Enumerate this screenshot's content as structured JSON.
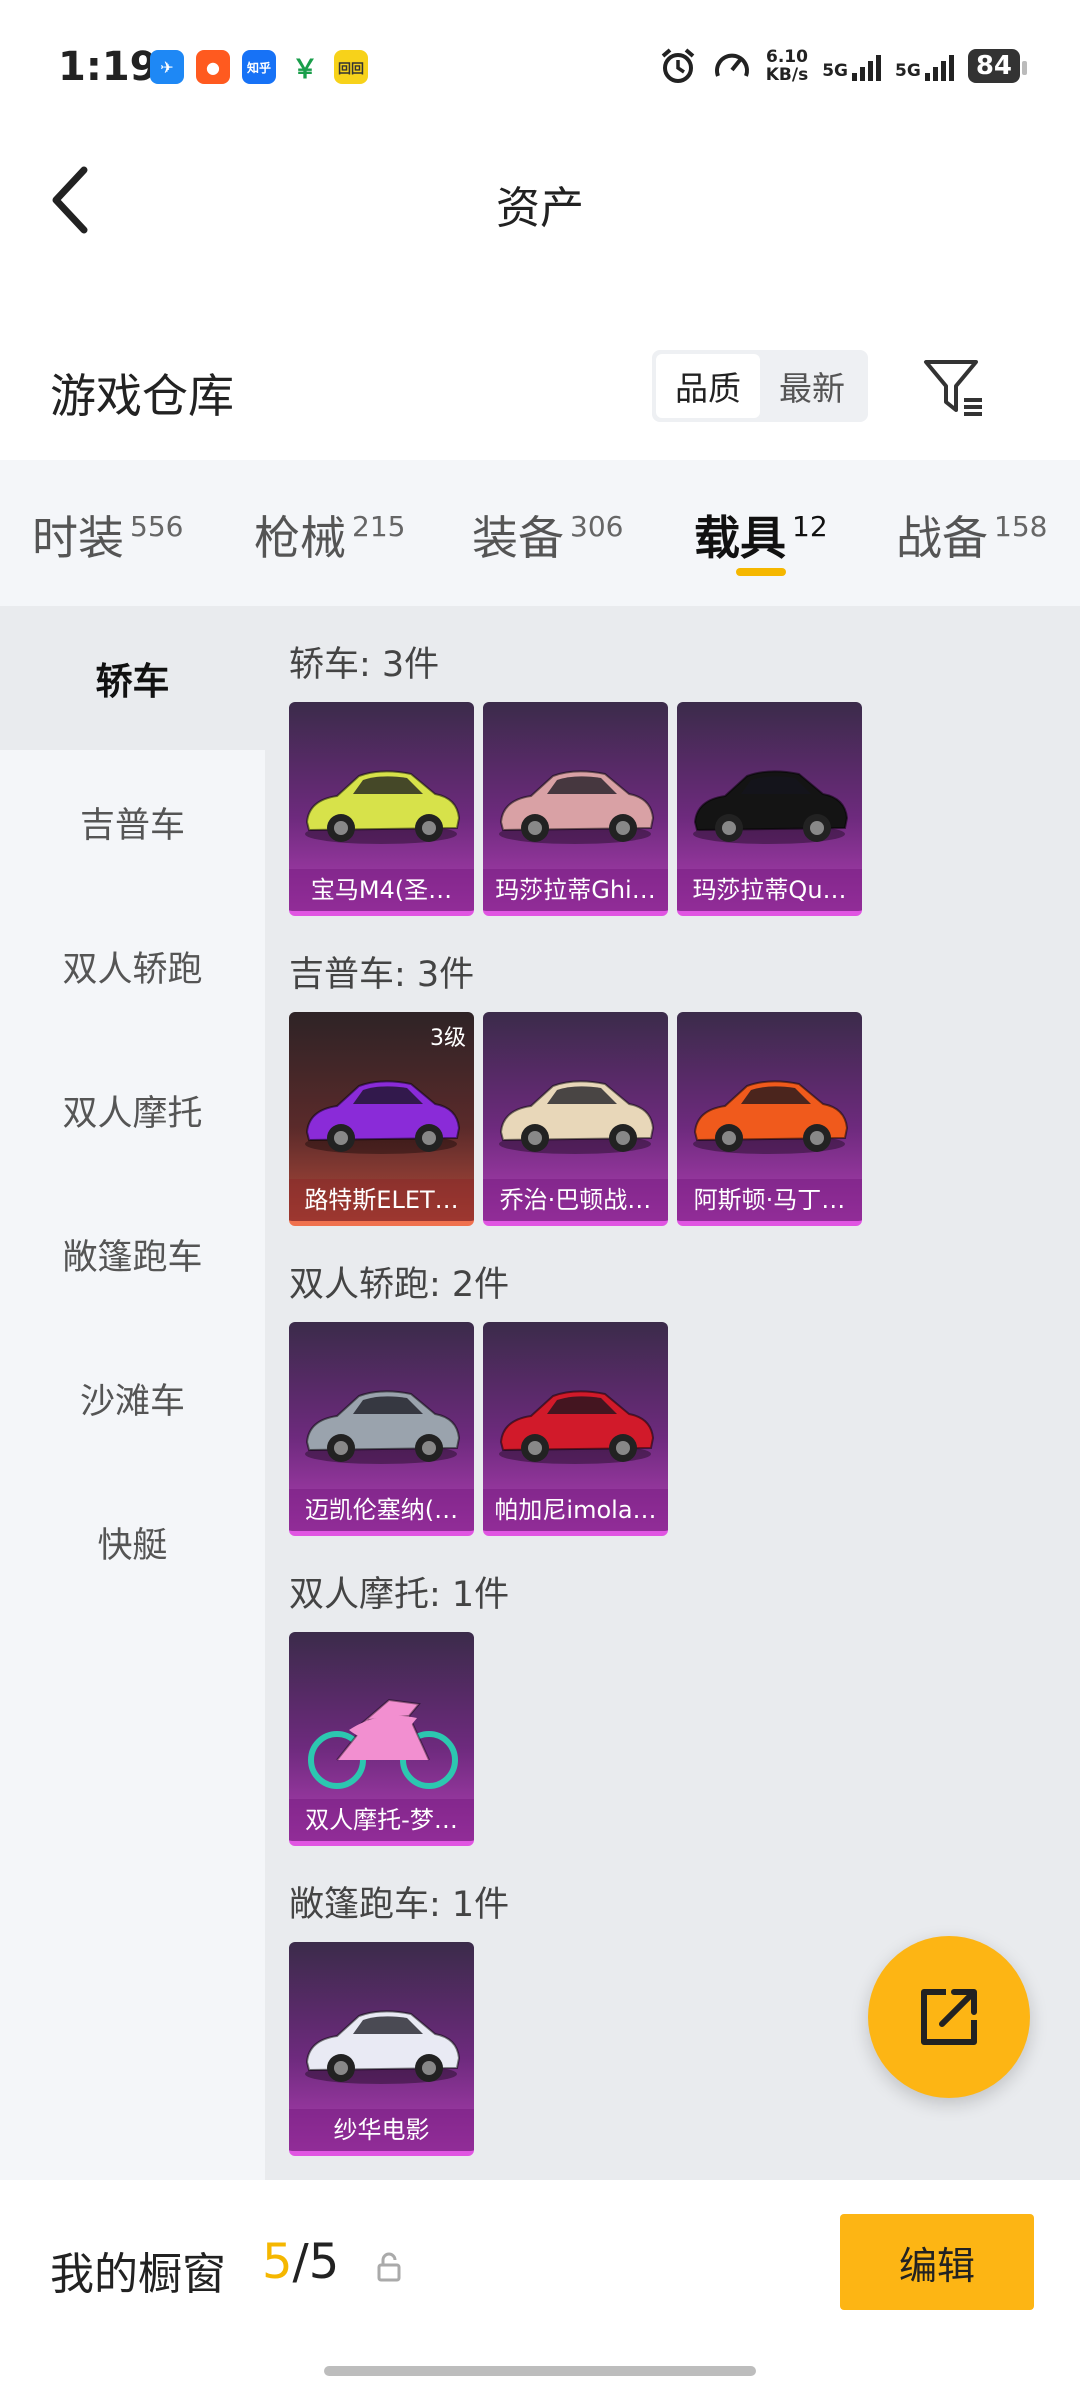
{
  "status_bar": {
    "time": "1:19",
    "net_speed_value": "6.10",
    "net_speed_unit": "KB/s",
    "network1": "5G",
    "network2": "5G",
    "battery": "84",
    "app_icons": [
      "maps-icon",
      "taobao-icon",
      "zhihu-icon",
      "finance-icon",
      "news-icon"
    ],
    "app_icon_labels": [
      "",
      "",
      "知乎",
      "",
      "回回"
    ]
  },
  "header": {
    "title": "资产"
  },
  "warehouse": {
    "title": "游戏仓库",
    "sort_options": [
      "品质",
      "最新"
    ],
    "sort_selected": "品质"
  },
  "tabs": [
    {
      "label": "时装",
      "count": "556"
    },
    {
      "label": "枪械",
      "count": "215"
    },
    {
      "label": "装备",
      "count": "306"
    },
    {
      "label": "载具",
      "count": "12",
      "active": true
    },
    {
      "label": "战备",
      "count": "158"
    }
  ],
  "sidebar": {
    "items": [
      {
        "label": "轿车",
        "active": true
      },
      {
        "label": "吉普车"
      },
      {
        "label": "双人轿跑"
      },
      {
        "label": "双人摩托"
      },
      {
        "label": "敞篷跑车"
      },
      {
        "label": "沙滩车"
      },
      {
        "label": "快艇"
      }
    ]
  },
  "sections": [
    {
      "title": "轿车: 3件",
      "items": [
        {
          "name": "宝马M4(圣…",
          "color": "#d7e24a"
        },
        {
          "name": "玛莎拉蒂Ghi…",
          "color": "#d9a1a5"
        },
        {
          "name": "玛莎拉蒂Qu…",
          "color": "#141414"
        }
      ]
    },
    {
      "title": "吉普车: 3件",
      "items": [
        {
          "name": "路特斯ELET…",
          "color": "#8a2bd8",
          "level": "3级",
          "rarity": "red"
        },
        {
          "name": "乔治·巴顿战…",
          "color": "#e8d7b9"
        },
        {
          "name": "阿斯顿·马丁…",
          "color": "#f05a1c"
        }
      ]
    },
    {
      "title": "双人轿跑: 2件",
      "items": [
        {
          "name": "迈凯伦塞纳(…",
          "color": "#9aa3ad"
        },
        {
          "name": "帕加尼imola…",
          "color": "#d11a2a"
        }
      ]
    },
    {
      "title": "双人摩托: 1件",
      "items": [
        {
          "name": "双人摩托-梦…",
          "color": "#f28fd0"
        }
      ]
    },
    {
      "title": "敞篷跑车: 1件",
      "items": [
        {
          "name": "纱华电影",
          "color": "#e9eaf4"
        }
      ]
    }
  ],
  "showcase": {
    "title": "我的橱窗",
    "current": "5",
    "separator": "/",
    "total": "5",
    "edit_label": "编辑"
  },
  "colors": {
    "accent": "#f5b700",
    "button": "#fdb514",
    "card_purple": "#6d2a7d",
    "card_red": "#b24a3a"
  }
}
